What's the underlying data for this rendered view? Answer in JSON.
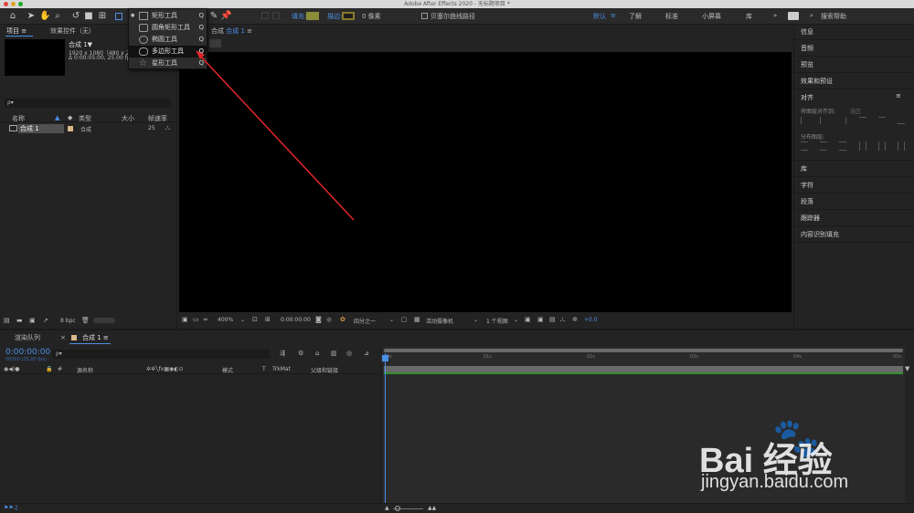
{
  "app": {
    "title": "Adobe After Effects 2020 - 无标题项目 *"
  },
  "toolbar": {
    "fill_label": "填充:",
    "stroke_label": "描边:",
    "stroke_width": "0 像素",
    "bezier_label": "贝塞尔曲线路径",
    "workspaces": [
      "默认",
      "了解",
      "标准",
      "小屏幕",
      "库"
    ],
    "search_placeholder": "搜索帮助",
    "fill_color": "#8b8b3a",
    "stroke_color": "#8b7a2a"
  },
  "shape_menu": {
    "items": [
      {
        "label": "矩形工具",
        "key": "Q",
        "icon": "rectangle-icon"
      },
      {
        "label": "圆角矩形工具",
        "key": "Q",
        "icon": "rounded-rectangle-icon"
      },
      {
        "label": "椭圆工具",
        "key": "Q",
        "icon": "ellipse-icon"
      },
      {
        "label": "多边形工具",
        "key": "Q",
        "icon": "polygon-icon"
      },
      {
        "label": "星形工具",
        "key": "Q",
        "icon": "star-icon"
      }
    ]
  },
  "project_panel": {
    "tab_project": "项目",
    "tab_effects": "效果控件（无）",
    "comp_name": "合成 1▼",
    "comp_info_1": "1920 x 1080（480 x 270）",
    "comp_info_2": "Δ 0:00:05:00, 25.00 fps",
    "search_placeholder": "ρ▾",
    "columns": [
      "名称",
      "类型",
      "大小",
      "帧速率"
    ],
    "rows": [
      {
        "name": "合成 1",
        "type": "合成",
        "size": "",
        "fps": "25"
      }
    ],
    "bpc": "8 bpc"
  },
  "comp_panel": {
    "tab_label": "合成",
    "tab_name": "合成 1",
    "zoom": "400%",
    "timecode": "0:00:00:00",
    "resolution": "四分之一",
    "camera": "活动摄像机",
    "views": "1 个视图",
    "exposure": "+0.0"
  },
  "right_panel": {
    "items_top": [
      "信息",
      "音频",
      "预览",
      "效果和预设"
    ],
    "align_title": "对齐",
    "align_to_label": "将图层对齐到:",
    "align_to_value": "选区",
    "distribute_label": "分布图层:",
    "items_bottom": [
      "库",
      "字符",
      "段落",
      "跟踪器",
      "内容识别填充"
    ]
  },
  "timeline": {
    "tab_render": "渲染队列",
    "tab_comp": "合成 1",
    "timecode": "0:00:00:00",
    "frame_info": "00000 (25.00 fps)",
    "search_placeholder": "ρ▾",
    "col_source": "源名称",
    "col_mode": "模式",
    "col_t": "T",
    "col_trkmat": "TrkMat",
    "col_parent": "父级和链接",
    "ruler_labels": [
      "0s",
      "01s",
      "02s",
      "03s",
      "04s",
      "05s"
    ],
    "work_area_color": "#2f8f2f",
    "accent": "#4a8fe6"
  },
  "watermark": {
    "brand": "Bai 经验",
    "url": "jingyan.baidu.com"
  }
}
